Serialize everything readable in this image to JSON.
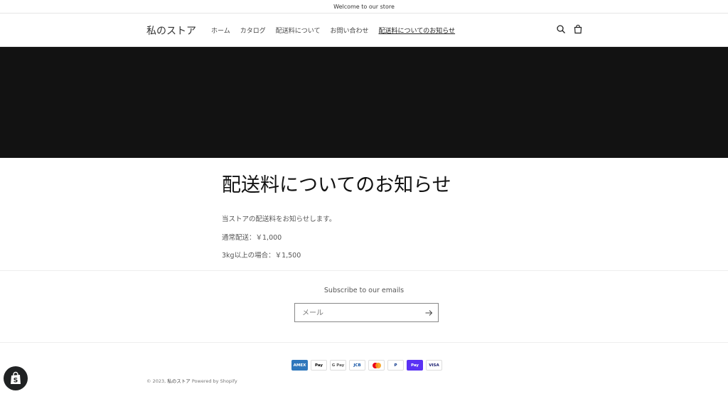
{
  "announcement": {
    "text": "Welcome to our store"
  },
  "header": {
    "logo": "私のストア",
    "nav": [
      {
        "label": "ホーム"
      },
      {
        "label": "カタログ"
      },
      {
        "label": "配送料について"
      },
      {
        "label": "お問い合わせ"
      },
      {
        "label": "配送料についてのお知らせ",
        "active": true
      }
    ],
    "icons": [
      "search-icon",
      "cart-icon"
    ]
  },
  "page": {
    "title": "配送料についてのお知らせ",
    "paragraphs": [
      "当ストアの配送料をお知らせします。",
      "通常配送：￥1,000",
      "3kg以上の場合：￥1,500"
    ]
  },
  "newsletter": {
    "title": "Subscribe to our emails",
    "placeholder": "メール"
  },
  "footer": {
    "payment_methods": [
      "American Express",
      "Apple Pay",
      "Google Pay",
      "JCB",
      "Mastercard",
      "PayPal",
      "Shop Pay",
      "Visa"
    ],
    "payment_labels": [
      "AMEX",
      "Pay",
      "G Pay",
      "JCB",
      "",
      "P",
      "Pay",
      "VISA"
    ],
    "copyright_prefix": "© 2023,",
    "copyright_store": "私のストア",
    "powered_by": "Powered by Shopify"
  },
  "colors": {
    "banner": "#121212",
    "shop_pay": "#5a31f4",
    "amex": "#2e77bc",
    "badge": "#202223"
  }
}
